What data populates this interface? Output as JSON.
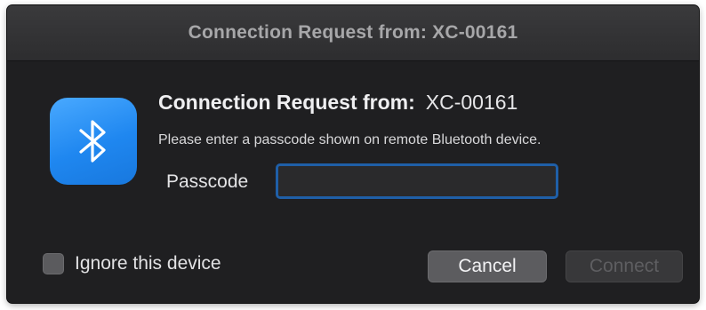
{
  "window": {
    "title": "Connection Request from: XC-00161"
  },
  "dialog": {
    "heading_label": "Connection Request from:",
    "heading_value": "XC-00161",
    "message": "Please enter a passcode shown on remote Bluetooth device.",
    "passcode_label": "Passcode",
    "passcode_value": ""
  },
  "footer": {
    "ignore_label": "Ignore this device",
    "ignore_checked": false,
    "cancel_label": "Cancel",
    "connect_label": "Connect"
  },
  "colors": {
    "window_bg": "#1f1f21",
    "icon_accent": "#1f87f0",
    "focus_ring": "#1f5fa8"
  },
  "icons": {
    "app_icon": "bluetooth-icon"
  }
}
